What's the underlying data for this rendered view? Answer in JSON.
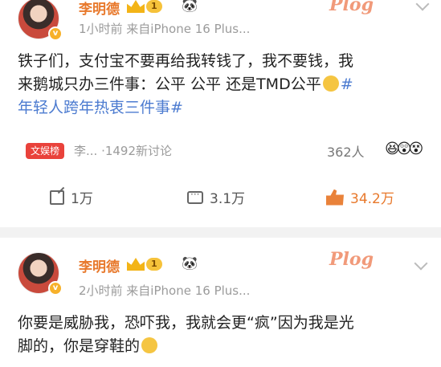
{
  "post1": {
    "username": "李明德",
    "level": "1",
    "meta": "1小时前  来自iPhone 16 Plus...",
    "sticker": "Plog",
    "text_line1": "铁子们，支付宝不要再给我转钱了，我不要钱，我",
    "text_line2": "来鹅城只办三件事：公平 公平 还是TMD公平",
    "text_tag1": "#",
    "text_line3": "年轻人跨年热衷三件事#",
    "topic_badge": "文娱榜",
    "topic_text": "李... ·1492新讨论",
    "readers": "362人",
    "share": "1万",
    "comments": "3.1万",
    "likes": "34.2万"
  },
  "post2": {
    "username": "李明德",
    "level": "1",
    "meta": "2小时前  来自iPhone 16 Plus...",
    "sticker": "Plog",
    "text_line1": "你要是威胁我，恐吓我，我就会更“疯”因为我是光",
    "text_line2": "脚的，你是穿鞋的"
  },
  "colors": {
    "accent": "#e8792c",
    "link": "#4c7bd0",
    "badge": "#e9423b"
  }
}
